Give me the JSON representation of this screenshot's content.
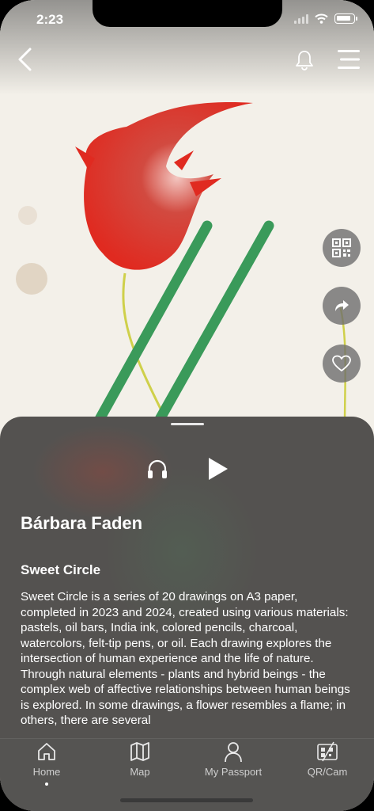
{
  "status_bar": {
    "time": "2:23"
  },
  "nav": {
    "back_icon": "chevron-left-icon",
    "bell_icon": "bell-icon",
    "menu_icon": "hamburger-menu-icon"
  },
  "actions": {
    "qr_icon": "qr-code-icon",
    "share_icon": "share-arrow-icon",
    "favorite_icon": "heart-icon"
  },
  "player": {
    "audio_icon": "headphones-icon",
    "play_icon": "play-icon"
  },
  "artwork": {
    "artist": "Bárbara Faden",
    "title": "Sweet Circle",
    "description": "Sweet Circle is a series of 20 drawings on A3 paper, completed in 2023 and 2024, created using various materials: pastels, oil bars, India ink, colored pencils, charcoal, watercolors, felt-tip pens, or oil. Each drawing explores the intersection of human experience and the life of nature. Through natural elements - plants and hybrid beings - the complex web of affective relationships between human beings is explored. In some drawings, a flower resembles a flame; in others, there are several"
  },
  "tabbar": {
    "items": [
      {
        "label": "Home",
        "icon": "home-icon",
        "active": true
      },
      {
        "label": "Map",
        "icon": "map-icon",
        "active": false
      },
      {
        "label": "My Passport",
        "icon": "person-icon",
        "active": false
      },
      {
        "label": "QR/Cam",
        "icon": "qr-cam-icon",
        "active": false
      }
    ]
  },
  "colors": {
    "sheet_bg": "#545250",
    "tulip_red": "#e0302a",
    "stem_green": "#3a9a5a",
    "paper": "#f3f0e9"
  }
}
